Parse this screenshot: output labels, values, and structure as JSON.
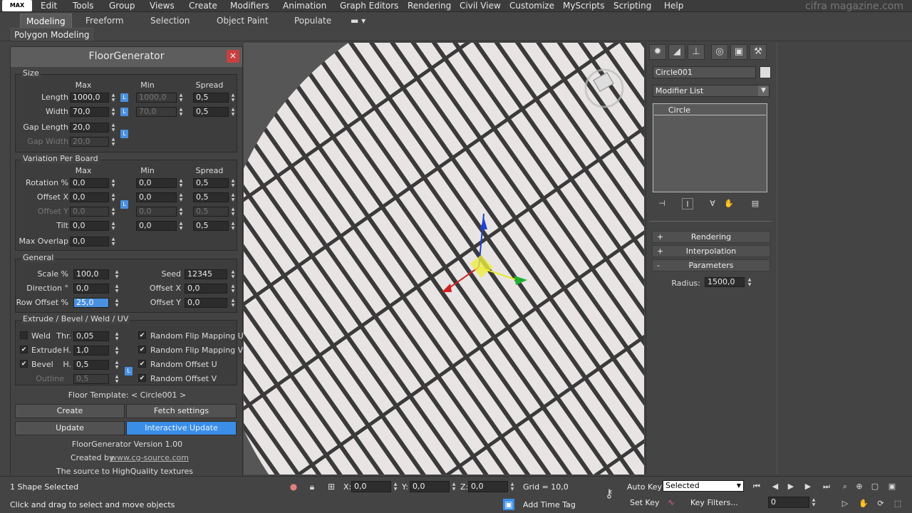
{
  "menubar": {
    "logo": "MAX",
    "items": [
      "Edit",
      "Tools",
      "Group",
      "Views",
      "Create",
      "Modifiers",
      "Animation",
      "Graph Editors",
      "Rendering",
      "Civil View",
      "Customize",
      "MyScripts",
      "Scripting",
      "Help"
    ],
    "brand": "cifra magazine.com"
  },
  "ribbon": {
    "tabs": [
      "Modeling",
      "Freeform",
      "Selection",
      "Object Paint",
      "Populate"
    ],
    "active_tab": "Modeling",
    "sub_tab": "Polygon Modeling"
  },
  "floorgen": {
    "title": "FloorGenerator",
    "close": "×",
    "size": {
      "label": "Size",
      "col_max": "Max",
      "col_min": "Min",
      "col_spread": "Spread",
      "length_label": "Length",
      "length_max": "1000,0",
      "length_min": "1000,0",
      "length_spread": "0,5",
      "width_label": "Width",
      "width_max": "70,0",
      "width_min": "70,0",
      "width_spread": "0,5",
      "gap_length_label": "Gap Length",
      "gap_length": "20,0",
      "gap_width_label": "Gap Width",
      "gap_width": "20,0"
    },
    "variation": {
      "label": "Variation Per Board",
      "col_max": "Max",
      "col_min": "Min",
      "col_spread": "Spread",
      "rotation_label": "Rotation %",
      "rotation_max": "0,0",
      "rotation_min": "0,0",
      "rotation_spread": "0,5",
      "offx_label": "Offset X",
      "offx_max": "0,0",
      "offx_min": "0,0",
      "offx_spread": "0,5",
      "offy_label": "Offset Y",
      "offy_max": "0,0",
      "offy_min": "0,0",
      "offy_spread": "0,5",
      "tilt_label": "Tilt",
      "tilt_max": "0,0",
      "tilt_min": "0,0",
      "tilt_spread": "0,5",
      "overlap_label": "Max Overlap",
      "overlap": "0,0"
    },
    "general": {
      "label": "General",
      "scale_label": "Scale %",
      "scale": "100,0",
      "seed_label": "Seed",
      "seed": "12345",
      "direction_label": "Direction °",
      "direction": "0,0",
      "offx_label": "Offset X",
      "offx": "0,0",
      "rowoff_label": "Row Offset %",
      "rowoff": "25,0",
      "offy_label": "Offset Y",
      "offy": "0,0"
    },
    "extrude": {
      "label": "Extrude / Bevel / Weld / UV",
      "weld_label": "Weld",
      "weld_checked": false,
      "thr_label": "Thr.",
      "thr": "0,05",
      "extrude_label": "Extrude",
      "extrude_checked": true,
      "h_label": "H.",
      "extrude_h": "1,0",
      "bevel_label": "Bevel",
      "bevel_checked": true,
      "bh_label": "H.",
      "bevel_h": "0,5",
      "outline_label": "Outline",
      "outline": "0,5",
      "rflip_u": "Random Flip Mapping U",
      "rflip_v": "Random Flip Mapping V",
      "roff_u": "Random Offset U",
      "roff_v": "Random Offset V"
    },
    "template": "Floor Template: < Circle001 >",
    "create": "Create",
    "fetch": "Fetch settings",
    "update": "Update",
    "interactive": "Interactive Update",
    "version": "FloorGenerator Version 1.00",
    "created_by": "Created by",
    "site": "www.cg-source.com",
    "tagline": "The source to HighQuality textures",
    "lock": "L"
  },
  "command_panel": {
    "object_name": "Circle001",
    "modifier_list": "Modifier List",
    "stack_item": "Circle",
    "rollouts": [
      {
        "sign": "+",
        "label": "Rendering"
      },
      {
        "sign": "+",
        "label": "Interpolation"
      },
      {
        "sign": "-",
        "label": "Parameters"
      }
    ],
    "radius_label": "Radius:",
    "radius": "1500,0"
  },
  "statusbar": {
    "selected": "1 Shape Selected",
    "prompt": "Click and drag to select and move objects",
    "x_label": "X:",
    "x": "0,0",
    "y_label": "Y:",
    "y": "0,0",
    "z_label": "Z:",
    "z": "0,0",
    "grid": "Grid = 10,0",
    "add_time_tag": "Add Time Tag",
    "auto_key": "Auto Key",
    "set_key": "Set Key",
    "selected_dropdown": "Selected",
    "key_filters": "Key Filters...",
    "frame": "0"
  },
  "colors": {
    "accent": "#3a8ee6",
    "close": "#c94040",
    "x_axis": "#d02020",
    "y_axis": "#20b030",
    "z_axis": "#2040d0"
  }
}
